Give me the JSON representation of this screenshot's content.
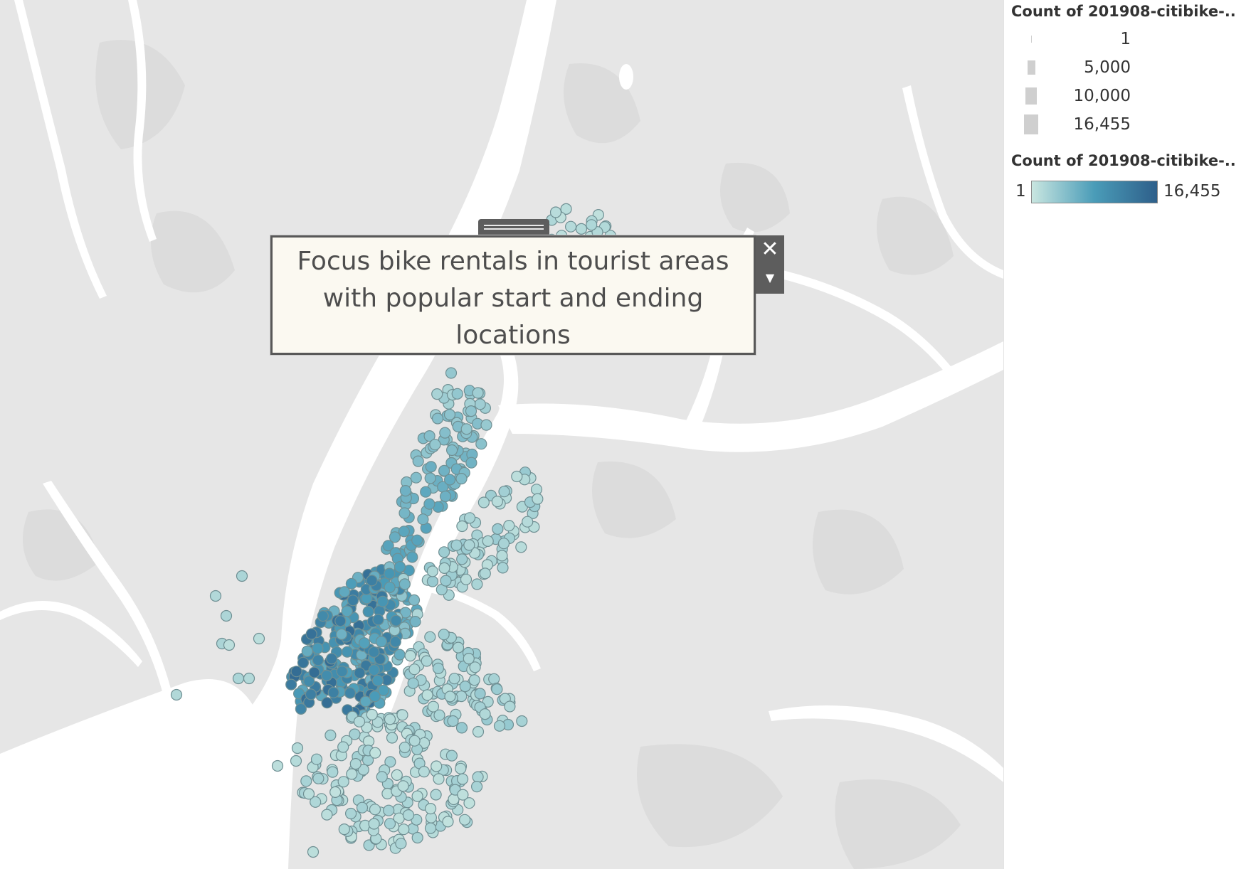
{
  "annotation": {
    "text": "Focus bike rentals in tourist areas with popular start and ending locations"
  },
  "controls": {
    "close_icon": "close-icon",
    "menu_icon": "caret-down-icon"
  },
  "legend": {
    "size_title": "Count of 201908-citibike-..",
    "size_items": [
      {
        "label": "1",
        "value": 1
      },
      {
        "label": "5,000",
        "value": 5000
      },
      {
        "label": "10,000",
        "value": 10000
      },
      {
        "label": "16,455",
        "value": 16455
      }
    ],
    "color_title": "Count of 201908-citibike-..",
    "color_min_label": "1",
    "color_max_label": "16,455",
    "color_min": "#c9e6e0",
    "color_mid": "#4a9cb8",
    "color_max": "#2e5f8a"
  },
  "map": {
    "land_color": "#e6e6e6",
    "water_color": "#ffffff",
    "marker_stroke": "#6f8f93"
  }
}
